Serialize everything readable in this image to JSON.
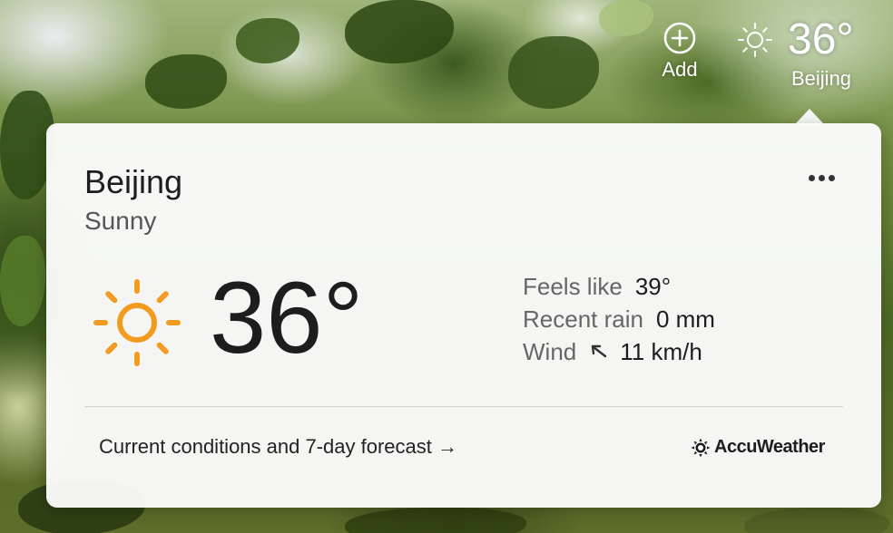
{
  "menubar": {
    "add_label": "Add",
    "weather_temp": "36°",
    "weather_city": "Beijing",
    "weather_icon": "sun-icon"
  },
  "popover": {
    "city": "Beijing",
    "condition": "Sunny",
    "temperature": "36°",
    "main_icon": "sun-icon",
    "details": {
      "feels_like_label": "Feels like",
      "feels_like_value": "39°",
      "recent_rain_label": "Recent rain",
      "recent_rain_value": "0 mm",
      "wind_label": "Wind",
      "wind_value": "11 km/h",
      "wind_direction_icon": "arrow-up-left-icon"
    },
    "forecast_link": "Current conditions and 7-day forecast →",
    "provider": "AccuWeather"
  },
  "colors": {
    "sun_orange": "#f29c1f",
    "text_primary": "#1d1d1f",
    "text_secondary": "#666666"
  }
}
